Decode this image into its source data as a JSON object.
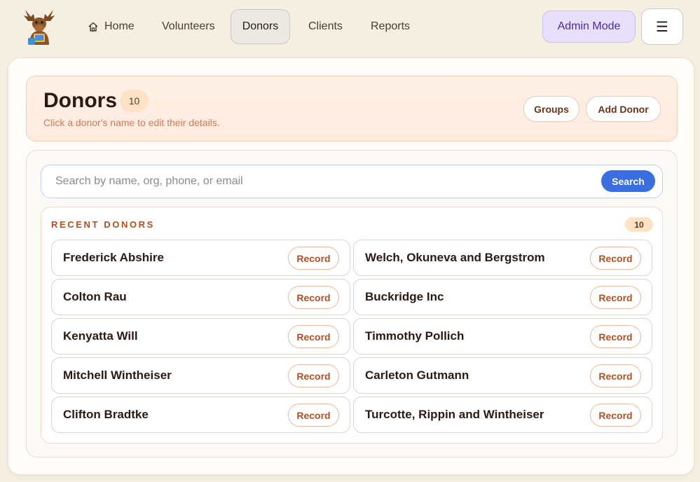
{
  "nav": {
    "items": [
      {
        "label": "Home",
        "icon": "home-icon"
      },
      {
        "label": "Volunteers"
      },
      {
        "label": "Donors",
        "active": true
      },
      {
        "label": "Clients"
      },
      {
        "label": "Reports"
      }
    ],
    "admin_label": "Admin Mode",
    "menu_glyph": "☰"
  },
  "header": {
    "title": "Donors",
    "count": "10",
    "subtitle": "Click a donor's name to edit their details.",
    "groups_label": "Groups",
    "add_label": "Add Donor"
  },
  "search": {
    "placeholder": "Search by name, org, phone, or email",
    "value": "",
    "button_label": "Search"
  },
  "recent": {
    "label": "RECENT DONORS",
    "count": "10",
    "record_label": "Record",
    "donors": [
      "Frederick Abshire",
      "Welch, Okuneva and Bergstrom",
      "Colton Rau",
      "Buckridge Inc",
      "Kenyatta Will",
      "Timmothy Pollich",
      "Mitchell Wintheiser",
      "Carleton Gutmann",
      "Clifton Bradtke",
      "Turcotte, Rippin and Wintheiser"
    ]
  },
  "colors": {
    "accent": "#3b6ee0",
    "admin_bg": "#e8e0fb",
    "record_text": "#b05023"
  }
}
